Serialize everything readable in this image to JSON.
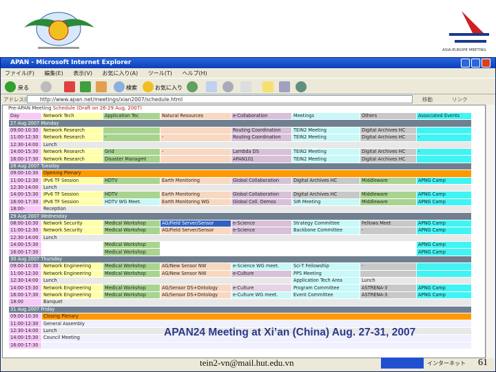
{
  "window": {
    "title": "APAN - Microsoft Internet Explorer",
    "menu": [
      "ファイル(F)",
      "編集(E)",
      "表示(V)",
      "お気に入り(A)",
      "ツール(T)",
      "ヘルプ(H)"
    ],
    "toolbar": {
      "back": "戻る",
      "search": "検索",
      "favorites": "お気に入り"
    },
    "address_label": "アドレス(D)",
    "url": "http://www.apan.net/meetings/xian2007/schedule.html",
    "go": "移動",
    "links": "リンク"
  },
  "page": {
    "heading_prefix": "Pre-APAN Meeting ",
    "heading_link": "Schedule (Draft on 26-29 Aug, 2007)"
  },
  "colors": {
    "d": "#f8c8f8",
    "n": "#ffffa8",
    "a": "#a8d490",
    "r": "#f8d8c0",
    "e": "#d8c0d8",
    "el": "#e4d4e4",
    "m": "#c8f8f8",
    "o": "#c8c8c8",
    "x": "#40f4f4",
    "g": "#e8e8e8",
    "w": "#ffffff",
    "day": "#708090",
    "or": "#ff9900",
    "l": "#f0f0ff",
    "sel": "#3060c0"
  },
  "schedule": [
    {
      "cells": [
        [
          "Day",
          "d"
        ],
        [
          "Network Tech",
          "n"
        ],
        [
          "Application Tec",
          "a"
        ],
        [
          "Natural Resources",
          "r"
        ],
        [
          "e-Collaboration",
          "e"
        ],
        [
          "Meetings",
          "m"
        ],
        [
          "Others",
          "o"
        ],
        [
          "Associated Events",
          "x"
        ]
      ]
    },
    {
      "day": "27 Aug 2007 Monday"
    },
    {
      "cells": [
        [
          "09:00-10:30",
          "d"
        ],
        [
          "Network Research",
          "n"
        ],
        [
          "",
          "a"
        ],
        [
          "",
          "r"
        ],
        [
          "Routing Coordination",
          "e"
        ],
        [
          "TEIN2 Meeting",
          "m"
        ],
        [
          "Digital Archives HC",
          "o"
        ],
        [
          "",
          "x"
        ]
      ]
    },
    {
      "cells": [
        [
          "11:00-12:30",
          "d"
        ],
        [
          "Network Research",
          "n"
        ],
        [
          "-",
          "a"
        ],
        [
          "-",
          "r"
        ],
        [
          "Routing Coordination",
          "e"
        ],
        [
          "TEIN2 Meeting",
          "m"
        ],
        [
          "Digital Archives HC",
          "o"
        ],
        [
          "-",
          "x"
        ]
      ]
    },
    {
      "cells": [
        [
          "12:30-14:00",
          "d"
        ],
        [
          "Lunch",
          "g",
          7
        ]
      ]
    },
    {
      "cells": [
        [
          "14:00-15:30",
          "d"
        ],
        [
          "Network Research",
          "n"
        ],
        [
          "Grid",
          "a"
        ],
        [
          "-",
          "r"
        ],
        [
          "Lambda DS",
          "e"
        ],
        [
          "TEIN2 Meeting",
          "m"
        ],
        [
          "Digital Archives HC",
          "o"
        ],
        [
          "-",
          "x"
        ]
      ]
    },
    {
      "cells": [
        [
          "16:00-17:30",
          "d"
        ],
        [
          "Network Research",
          "n"
        ],
        [
          "Disaster Managmt",
          "a"
        ],
        [
          "",
          "r"
        ],
        [
          "APAN101",
          "e"
        ],
        [
          "TEIN2 Meeting",
          "m"
        ],
        [
          "Digital Archives HC",
          "o"
        ],
        [
          "",
          "x"
        ]
      ]
    },
    {
      "day": "28 Aug 2007 Tuesday"
    },
    {
      "cells": [
        [
          "09:00-10:30",
          "d"
        ],
        [
          "Opening Plenary",
          "or",
          7
        ]
      ]
    },
    {
      "cells": [
        [
          "11:00-12:30",
          "d"
        ],
        [
          "IPv6 TF Session",
          "n"
        ],
        [
          "HDTV",
          "a"
        ],
        [
          "Earth Monitoring",
          "r"
        ],
        [
          "Global Collaboration",
          "e"
        ],
        [
          "Digital Archives HC",
          "o"
        ],
        [
          "Middleware",
          "a"
        ],
        [
          "APNG Camp",
          "x"
        ]
      ]
    },
    {
      "cells": [
        [
          "12:30-14:00",
          "d"
        ],
        [
          "Lunch",
          "g",
          7
        ]
      ]
    },
    {
      "cells": [
        [
          "14:00-15:30",
          "d"
        ],
        [
          "IPv6 TF Session",
          "n"
        ],
        [
          "HDTV",
          "a"
        ],
        [
          "Earth Monitoring",
          "r"
        ],
        [
          "Global Collaboration",
          "e"
        ],
        [
          "Digital Archives HC",
          "o"
        ],
        [
          "Middleware",
          "a"
        ],
        [
          "APNG Camp",
          "x"
        ]
      ]
    },
    {
      "cells": [
        [
          "16:00-17:30",
          "d"
        ],
        [
          "IPv6 TF Session",
          "n"
        ],
        [
          "HDTV WG Meet.",
          "m"
        ],
        [
          "Earth Monitoring WG",
          "r"
        ],
        [
          "Global Coll. Demos",
          "e"
        ],
        [
          "SIR Meeting",
          "m"
        ],
        [
          "Middleware",
          "a"
        ],
        [
          "APNG Camp",
          "x"
        ]
      ]
    },
    {
      "cells": [
        [
          "18:00-",
          "d"
        ],
        [
          "Reception",
          "g",
          7
        ]
      ]
    },
    {
      "day": "29 Aug 2007 Wednesday"
    },
    {
      "cells": [
        [
          "08:00-10:30",
          "d"
        ],
        [
          "Network Security",
          "n"
        ],
        [
          "Medical Workshop",
          "a"
        ],
        [
          "AG/Field Server/Sensor",
          "sel"
        ],
        [
          "e-Science",
          "e"
        ],
        [
          "Strategy Committee",
          "m"
        ],
        [
          "Fellows Meet",
          "o"
        ],
        [
          "APNG Camp",
          "x"
        ]
      ]
    },
    {
      "cells": [
        [
          "11:00-12:30",
          "d"
        ],
        [
          "Network Security",
          "n"
        ],
        [
          "Medical Workshop",
          "a"
        ],
        [
          "AG/Field Server/Sensor",
          "r"
        ],
        [
          "e-Science",
          "e"
        ],
        [
          "Backbone Committee",
          "m"
        ],
        [
          "-",
          "o"
        ],
        [
          "APNG Camp",
          "x"
        ]
      ]
    },
    {
      "cells": [
        [
          "12:30-14:00",
          "d"
        ],
        [
          "Lunch",
          "g",
          7
        ]
      ]
    },
    {
      "cells": [
        [
          "14:00-15:30",
          "d"
        ],
        [
          "",
          "w"
        ],
        [
          "Medical Workshop",
          "a"
        ],
        [
          "",
          "w"
        ],
        [
          "",
          "w"
        ],
        [
          "",
          "w"
        ],
        [
          "",
          "w"
        ],
        [
          "APNG Camp",
          "x"
        ]
      ]
    },
    {
      "cells": [
        [
          "16:00-17:30",
          "d"
        ],
        [
          "",
          "w"
        ],
        [
          "Medical Workshop",
          "a"
        ],
        [
          "",
          "w"
        ],
        [
          "",
          "w"
        ],
        [
          "",
          "w"
        ],
        [
          "",
          "w"
        ],
        [
          "APNG Camp",
          "x"
        ]
      ]
    },
    {
      "day": "30 Aug 2007 Thursday"
    },
    {
      "cells": [
        [
          "09:00-10:30",
          "d"
        ],
        [
          "Network Engineering",
          "n"
        ],
        [
          "Medical Workshop",
          "a"
        ],
        [
          "AG/New Sensor NW",
          "r"
        ],
        [
          "e-Science WG meet.",
          "m"
        ],
        [
          "Sci-T Fellowship",
          "m"
        ],
        [
          "-",
          "o"
        ],
        [
          "",
          "x"
        ]
      ]
    },
    {
      "cells": [
        [
          "11:00-12:30",
          "d"
        ],
        [
          "Network Engineering",
          "n"
        ],
        [
          "Medical Workshop",
          "a"
        ],
        [
          "AG/New Sensor NW",
          "r"
        ],
        [
          "e-Culture",
          "e"
        ],
        [
          "PPS Meeting",
          "m"
        ],
        [
          "",
          "o"
        ],
        [
          "",
          "x"
        ]
      ]
    },
    {
      "cells": [
        [
          "12:30-14:00",
          "d"
        ],
        [
          "Lunch",
          "g",
          4
        ],
        [
          "Application Tech Area",
          "m"
        ],
        [
          "Lunch",
          "g"
        ],
        [
          "",
          "g"
        ]
      ]
    },
    {
      "cells": [
        [
          "14:00-15:30",
          "d"
        ],
        [
          "Network Engineering",
          "n"
        ],
        [
          "Medical Workshop",
          "a"
        ],
        [
          "AG/Sensor DS+Ontology",
          "r"
        ],
        [
          "e-Culture",
          "el"
        ],
        [
          "Program Committee",
          "m"
        ],
        [
          "ASTRENA-3",
          "o"
        ],
        [
          "APNG Camp",
          "x"
        ]
      ]
    },
    {
      "cells": [
        [
          "16:00-17:30",
          "d"
        ],
        [
          "Network Engineering",
          "n"
        ],
        [
          "Medical Workshop",
          "a"
        ],
        [
          "AG/Sensor DS+Ontology",
          "r"
        ],
        [
          "e-Culture WG meet.",
          "m"
        ],
        [
          "Event Committee",
          "m"
        ],
        [
          "ASTRENA-3",
          "o"
        ],
        [
          "APNG Camp",
          "x"
        ]
      ]
    },
    {
      "cells": [
        [
          "18:00",
          "d"
        ],
        [
          "Banquet",
          "g",
          7
        ]
      ]
    },
    {
      "day": "31 Aug 2007 Friday"
    },
    {
      "cells": [
        [
          "09:00-10:30",
          "d"
        ],
        [
          "Closing Plenary",
          "or",
          7
        ]
      ]
    },
    {
      "cells": [
        [
          "11:00-12:30",
          "d"
        ],
        [
          "General Assembly",
          "l",
          7
        ]
      ]
    },
    {
      "cells": [
        [
          "12:30-14:00",
          "d"
        ],
        [
          "Lunch",
          "g",
          7
        ]
      ]
    },
    {
      "cells": [
        [
          "14:00-15:30",
          "d"
        ],
        [
          "Council Meeting",
          "l",
          7
        ]
      ]
    },
    {
      "cells": [
        [
          "16:00-17:30",
          "d"
        ],
        [
          "",
          "l",
          7
        ]
      ]
    }
  ],
  "status": {
    "zone": "インターネット"
  },
  "slide": {
    "overlay": "APAN24 Meeting at Xi’an (China) Aug. 27-31, 2007",
    "footer": "tein2-vn@mail.hut.edu.vn",
    "page_number": "61",
    "right_logo_text": "ASIA-EUROPE MEETING"
  }
}
